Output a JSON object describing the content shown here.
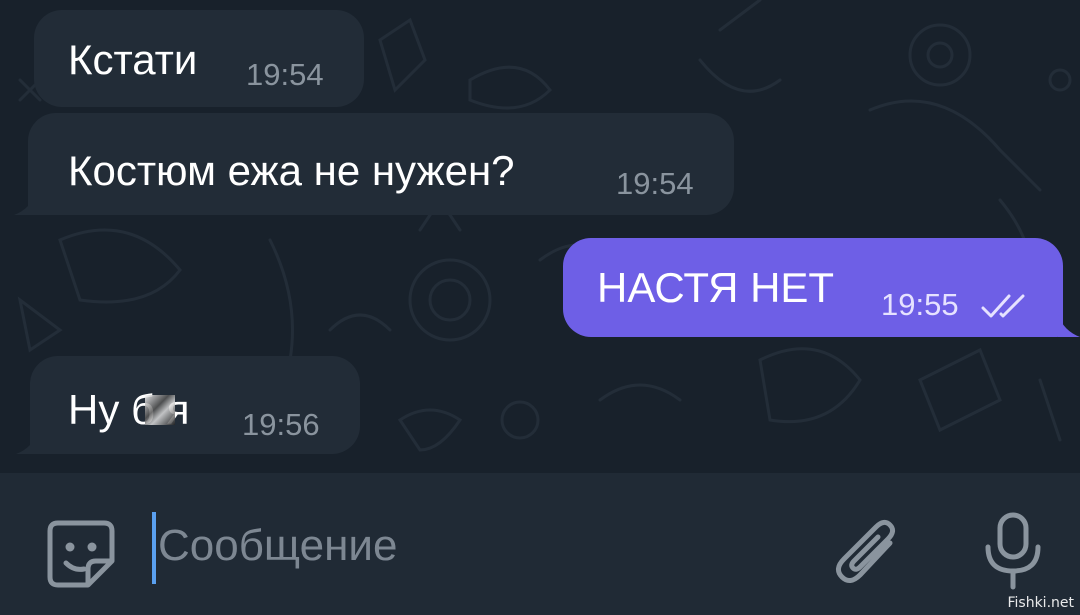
{
  "messages": [
    {
      "direction": "in",
      "text": "Кстати",
      "time": "19:54"
    },
    {
      "direction": "in",
      "text": "Костюм ежа не нужен?",
      "time": "19:54"
    },
    {
      "direction": "out",
      "text": "НАСТЯ НЕТ",
      "time": "19:55",
      "status_icon": "double-check-icon"
    },
    {
      "direction": "in",
      "text": "Ну б  я",
      "time": "19:56"
    }
  ],
  "composer": {
    "placeholder": "Сообщение",
    "emoji_icon": "sticker-smile-icon",
    "attach_icon": "paperclip-icon",
    "mic_icon": "microphone-icon"
  },
  "watermark": "Fishki.net",
  "colors": {
    "chat_background": "#18212b",
    "incoming_bubble": "#222c37",
    "outgoing_bubble": "#6e5fe6",
    "input_bar": "#202a35",
    "caret": "#5aa0f0"
  }
}
